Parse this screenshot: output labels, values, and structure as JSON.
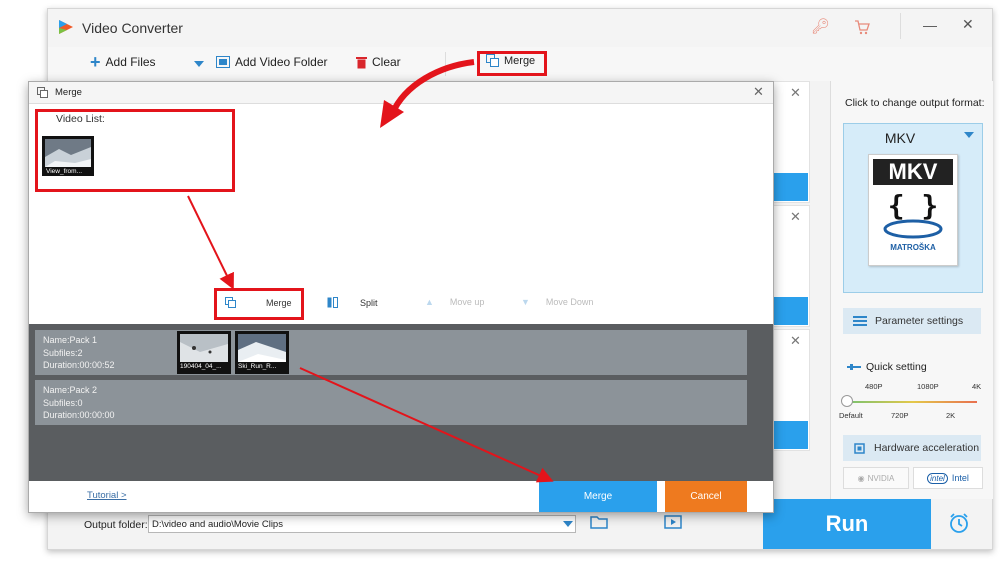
{
  "app": {
    "title": "Video Converter",
    "toolbar": {
      "add_files": "Add Files",
      "add_video_folder": "Add Video Folder",
      "clear": "Clear",
      "merge": "Merge"
    },
    "title_icons": [
      "key-icon",
      "cart-icon",
      "minimize-icon",
      "close-icon"
    ]
  },
  "right_panel": {
    "click_label": "Click to change output format:",
    "format": "MKV",
    "format_icon_text": "MKV",
    "format_icon_sub": "MATROŠKA",
    "parameter_settings": "Parameter settings",
    "quick_setting": "Quick setting",
    "quality_top": [
      "480P",
      "1080P",
      "4K"
    ],
    "quality_bottom": [
      "Default",
      "720P",
      "2K"
    ],
    "quality_level": 0,
    "hardware_acceleration": "Hardware acceleration",
    "nvidia": "NVIDIA",
    "intel": "Intel"
  },
  "bottom": {
    "output_folder_label": "Output folder:",
    "output_folder_value": "D:\\video and audio\\Movie Clips",
    "run": "Run"
  },
  "dialog": {
    "title": "Merge",
    "video_list_label": "Video List:",
    "video_list": [
      {
        "name": "View_from..."
      }
    ],
    "tools": {
      "merge": "Merge",
      "split": "Split",
      "move_up": "Move up",
      "move_down": "Move Down"
    },
    "packs": [
      {
        "name": "Name:Pack 1",
        "subfiles": "Subfiles:2",
        "duration": "Duration:00:00:52",
        "thumbs": [
          "190404_04_...",
          "Ski_Run_R..."
        ]
      },
      {
        "name": "Name:Pack 2",
        "subfiles": "Subfiles:0",
        "duration": "Duration:00:00:00",
        "thumbs": []
      }
    ],
    "tutorial": "Tutorial >",
    "merge_button": "Merge",
    "cancel_button": "Cancel"
  },
  "colors": {
    "accent_blue": "#2aa0ec",
    "cancel_orange": "#ee7a1f",
    "annotation_red": "#e3141b",
    "pack_bg": "#5a5d60"
  }
}
